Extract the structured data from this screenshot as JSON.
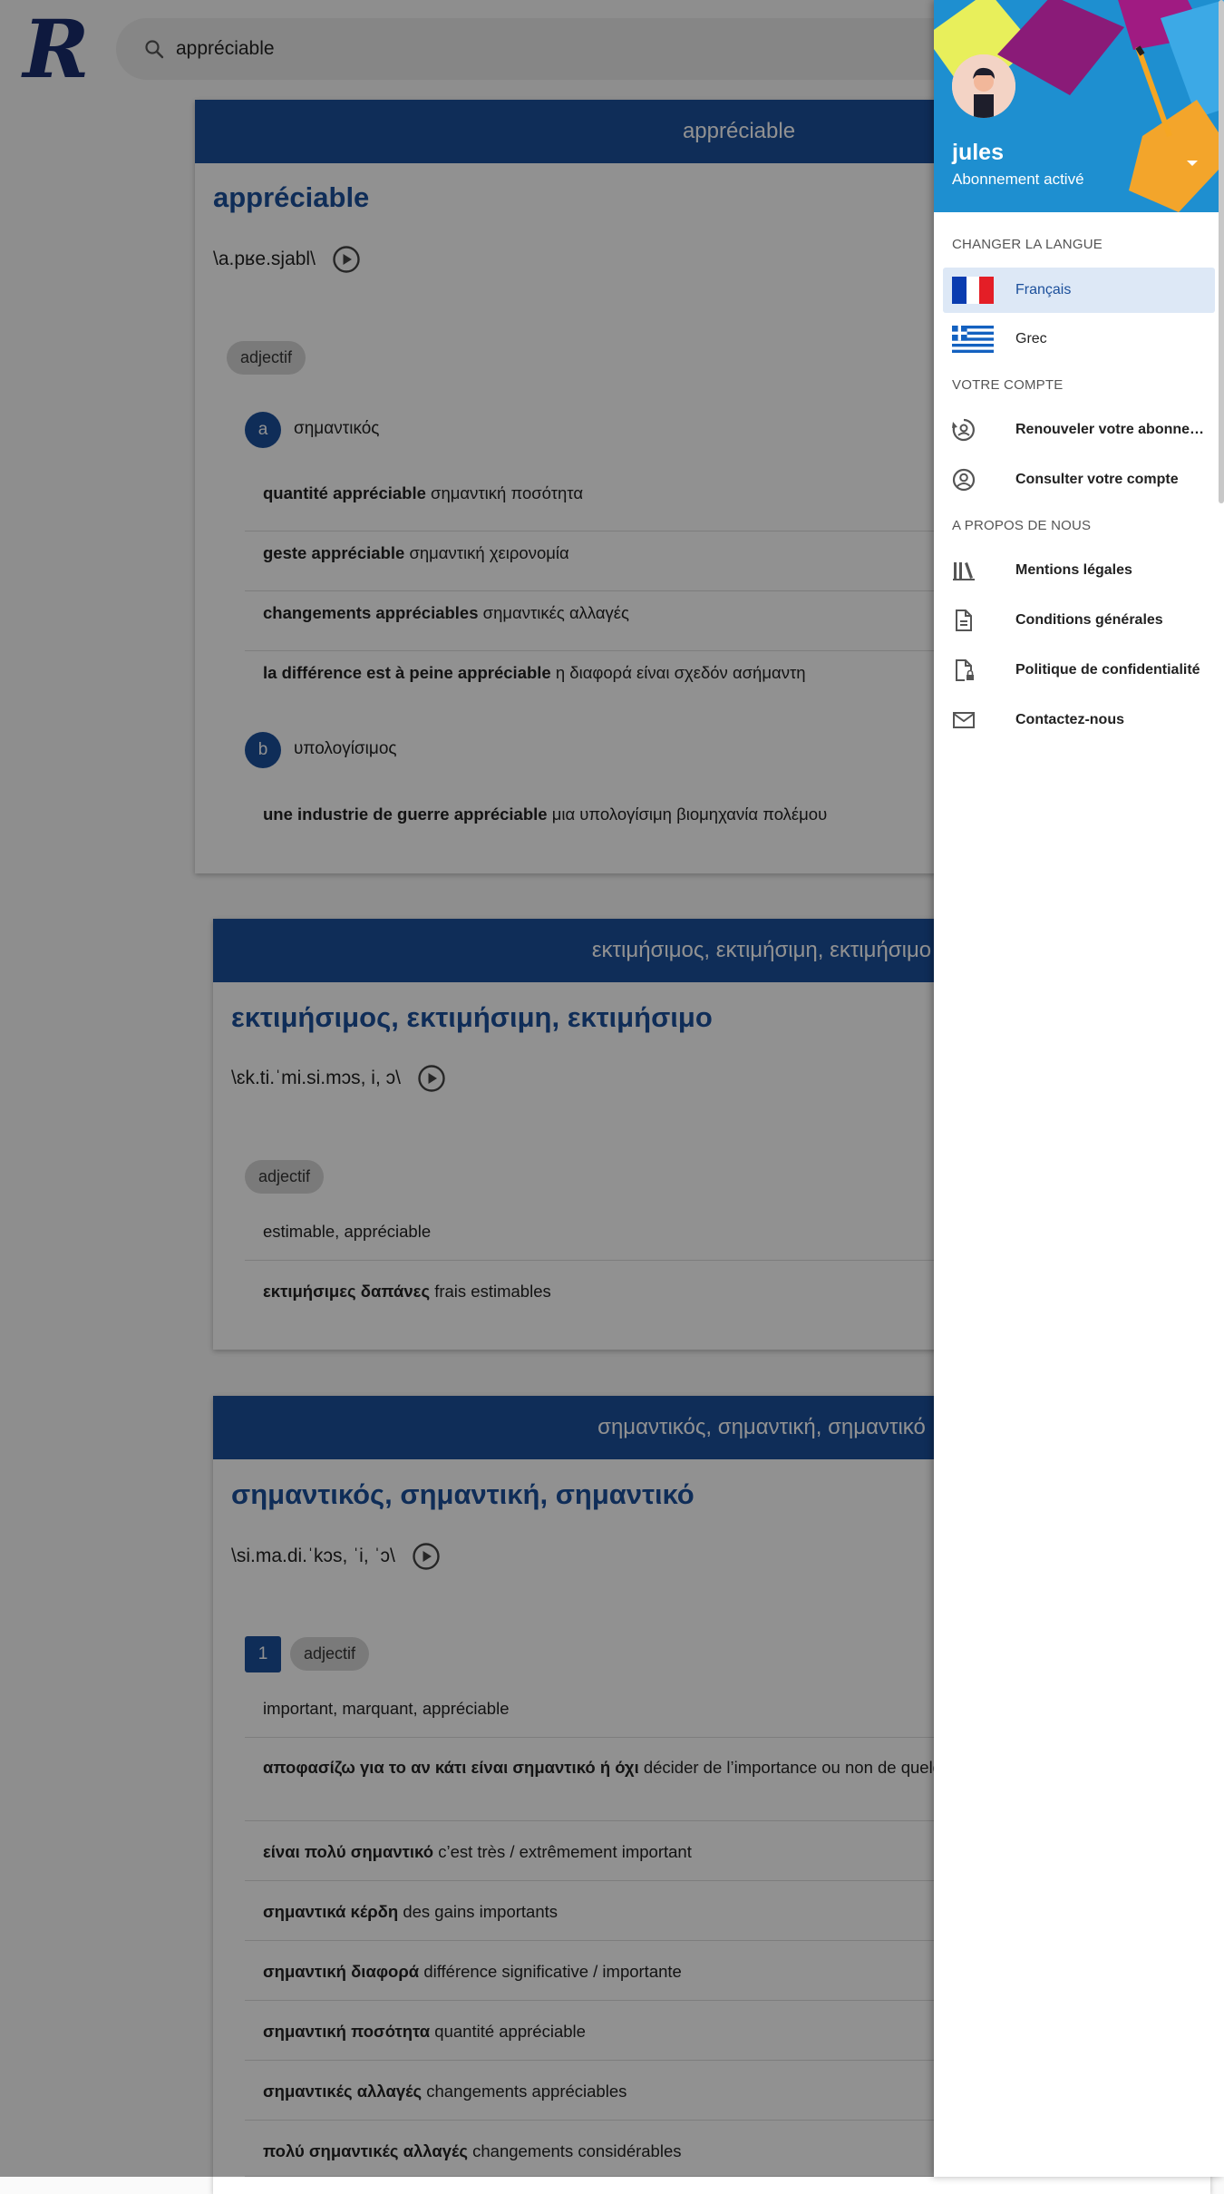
{
  "app": {
    "logo_letter": "R"
  },
  "search": {
    "value": "appréciable",
    "placeholder": ""
  },
  "entries": [
    {
      "banner": "appréciable",
      "headword": "appréciable",
      "phonetic": "\\a.pʁe.sjabl\\",
      "pos": "adjectif",
      "senses": [
        {
          "marker": "a",
          "label": "σημαντικός",
          "examples": [
            {
              "term": "quantité appréciable",
              "translation": "σημαντική ποσότητα"
            },
            {
              "term": "geste appréciable",
              "translation": "σημαντική χειρονομία"
            },
            {
              "term": "changements appréciables",
              "translation": "σημαντικές αλλαγές"
            },
            {
              "term": "la différence est à peine appréciable",
              "translation": "η διαφορά είναι σχεδόν ασήμαντη"
            }
          ]
        },
        {
          "marker": "b",
          "label": "υπολογίσιμος",
          "examples": [
            {
              "term": "une industrie de guerre appréciable",
              "translation": "μια υπολογίσιμη βιομηχανία πολέμου"
            }
          ]
        }
      ]
    },
    {
      "banner": "εκτιμήσιμος, εκτιμήσιμη, εκτιμήσιμο",
      "headword": "εκτιμήσιμος, εκτιμήσιμη, εκτιμήσιμο",
      "phonetic": "\\ɛk.ti.ˈmi.si.mɔs, i, ɔ\\",
      "pos": "adjectif",
      "rows": [
        {
          "term": "",
          "translation": "estimable, appréciable"
        },
        {
          "term": "εκτιμήσιμες δαπάνες",
          "translation": "frais estimables"
        }
      ]
    },
    {
      "banner": "σημαντικός, σημαντική, σημαντικό",
      "headword": "σημαντικός, σημαντική, σημαντικό",
      "phonetic": "\\si.ma.di.ˈkɔs, ˈi, ˈɔ\\",
      "number": "1",
      "pos": "adjectif",
      "rows": [
        {
          "term": "",
          "translation": "important, marquant, appréciable"
        },
        {
          "term": "αποφασίζω για το αν κάτι είναι σημαντικό ή όχι",
          "translation": "décider de l’importance ou non de quelque chose"
        },
        {
          "term": "είναι πολύ σημαντικό",
          "translation": "c’est très / extrêmement important"
        },
        {
          "term": "σημαντικά κέρδη",
          "translation": "des gains importants"
        },
        {
          "term": "σημαντική διαφορά",
          "translation": "différence significative / importante"
        },
        {
          "term": "σημαντική ποσότητα",
          "translation": "quantité appréciable"
        },
        {
          "term": "σημαντικές αλλαγές",
          "translation": "changements appréciables"
        },
        {
          "term": "πολύ σημαντικές αλλαγές",
          "translation": "changements considérables"
        }
      ]
    }
  ],
  "drawer": {
    "user": {
      "name": "jules",
      "status": "Abonnement activé"
    },
    "sections": {
      "language": "CHANGER LA LANGUE",
      "account": "VOTRE COMPTE",
      "about": "A PROPOS DE NOUS"
    },
    "languages": [
      {
        "label": "Français",
        "icon": "french-flag-icon",
        "active": true
      },
      {
        "label": "Grec",
        "icon": "greek-flag-icon",
        "active": false
      }
    ],
    "account_items": [
      {
        "label": "Renouveler votre abonnement",
        "icon": "renew-account-icon"
      },
      {
        "label": "Consulter votre compte",
        "icon": "account-circle-icon"
      }
    ],
    "about_items": [
      {
        "label": "Mentions légales",
        "icon": "library-books-icon"
      },
      {
        "label": "Conditions générales",
        "icon": "document-icon"
      },
      {
        "label": "Politique de confidentialité",
        "icon": "document-lock-icon"
      },
      {
        "label": "Contactez-nous",
        "icon": "mail-icon"
      }
    ]
  },
  "colors": {
    "accent": "#1b4f9b",
    "active_bg": "#dde8f6",
    "flag_fr_blue": "#0a3cb0",
    "flag_fr_red": "#e41e26",
    "flag_gr_blue": "#1361c0"
  }
}
